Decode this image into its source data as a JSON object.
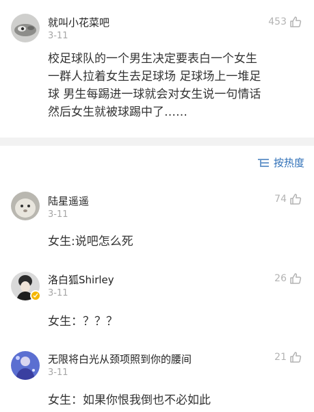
{
  "post": {
    "username": "就叫小花菜吧",
    "date": "3-11",
    "likes": "453",
    "body_lines": [
      "校足球队的一个男生决定要表白一个女生",
      "一群人拉着女生去足球场 足球场上一堆足",
      "球 男生每踢进一球就会对女生说一句情话",
      "然后女生就被球踢中了……"
    ]
  },
  "sort": {
    "label": "按热度"
  },
  "comments": [
    {
      "username": "陆星遥遥",
      "date": "3-11",
      "likes": "74",
      "text": "女生:说吧怎么死"
    },
    {
      "username": "洛白狐Shirley",
      "date": "3-11",
      "likes": "26",
      "text": "女生：？？？"
    },
    {
      "username": "无限将白光从颈项照到你的腰间",
      "date": "3-11",
      "likes": "21",
      "text": "女生：如果你恨我倒也不必如此"
    }
  ],
  "colors": {
    "accent": "#2e6fb7",
    "muted": "#a6a6a6",
    "badge": "#f5b700"
  },
  "icons": {
    "like": "thumbs-up-icon",
    "sort": "sort-lines-icon",
    "verified": "verified-badge-icon"
  }
}
